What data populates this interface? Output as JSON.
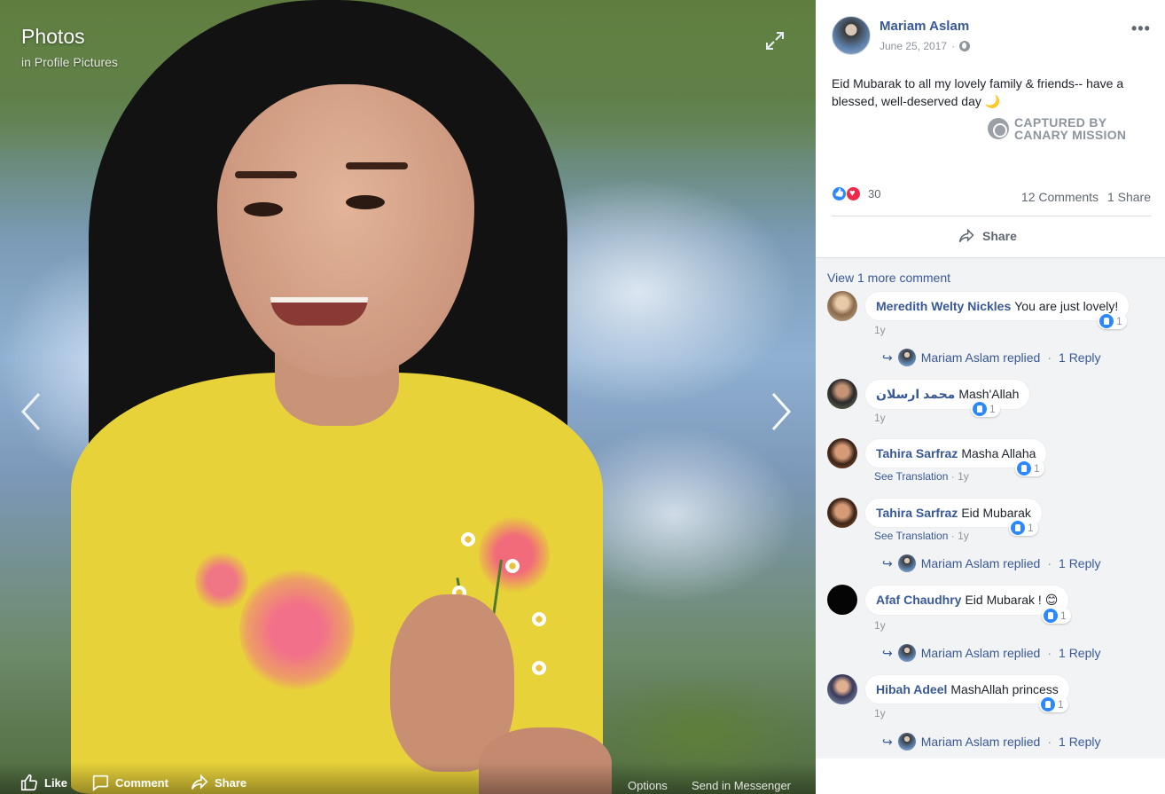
{
  "viewer": {
    "title": "Photos",
    "subtitle": "in Profile Pictures",
    "bottom": {
      "like": "Like",
      "comment": "Comment",
      "share": "Share",
      "options": "Options",
      "send": "Send in Messenger"
    }
  },
  "post": {
    "author": "Mariam Aslam",
    "date": "June 25, 2017",
    "text": "Eid Mubarak to all my lovely family & friends-- have a blessed, well-deserved day",
    "emoji": "🌙",
    "watermark_line1": "CAPTURED BY",
    "watermark_line2": "CANARY MISSION",
    "reaction_count": "30",
    "comments_count": "12 Comments",
    "shares_count": "1 Share",
    "share_label": "Share"
  },
  "comments": {
    "view_more": "View 1 more comment",
    "items": [
      {
        "author": "Meredith Welty Nickles",
        "text": "You are just lovely!",
        "likes": "1",
        "time": "1y",
        "see_translation": "",
        "reply": {
          "who": "Mariam Aslam replied",
          "count": "1 Reply"
        }
      },
      {
        "author": "محمد ارسلان",
        "text": "Mash'Allah",
        "likes": "1",
        "time": "1y",
        "see_translation": "",
        "reply": null
      },
      {
        "author": "Tahira Sarfraz",
        "text": "Masha Allaha",
        "likes": "1",
        "time": "1y",
        "see_translation": "See Translation",
        "reply": null
      },
      {
        "author": "Tahira Sarfraz",
        "text": "Eid Mubarak",
        "likes": "1",
        "time": "1y",
        "see_translation": "See Translation",
        "reply": {
          "who": "Mariam Aslam replied",
          "count": "1 Reply"
        }
      },
      {
        "author": "Afaf Chaudhry",
        "text": "Eid Mubarak ! 😊",
        "likes": "1",
        "time": "1y",
        "see_translation": "",
        "reply": {
          "who": "Mariam Aslam replied",
          "count": "1 Reply"
        }
      },
      {
        "author": "Hibah Adeel",
        "text": "MashAllah princess",
        "likes": "1",
        "time": "1y",
        "see_translation": "",
        "reply": {
          "who": "Mariam Aslam replied",
          "count": "1 Reply"
        }
      }
    ]
  },
  "colors": {
    "link": "#385898",
    "like_blue": "#2d88ff",
    "love_red": "#f0284a"
  },
  "icons": [
    "expand-icon",
    "chevron-left-icon",
    "chevron-right-icon",
    "like-icon",
    "comment-icon",
    "share-icon",
    "globe-icon",
    "more-icon",
    "reply-arrow-icon"
  ]
}
